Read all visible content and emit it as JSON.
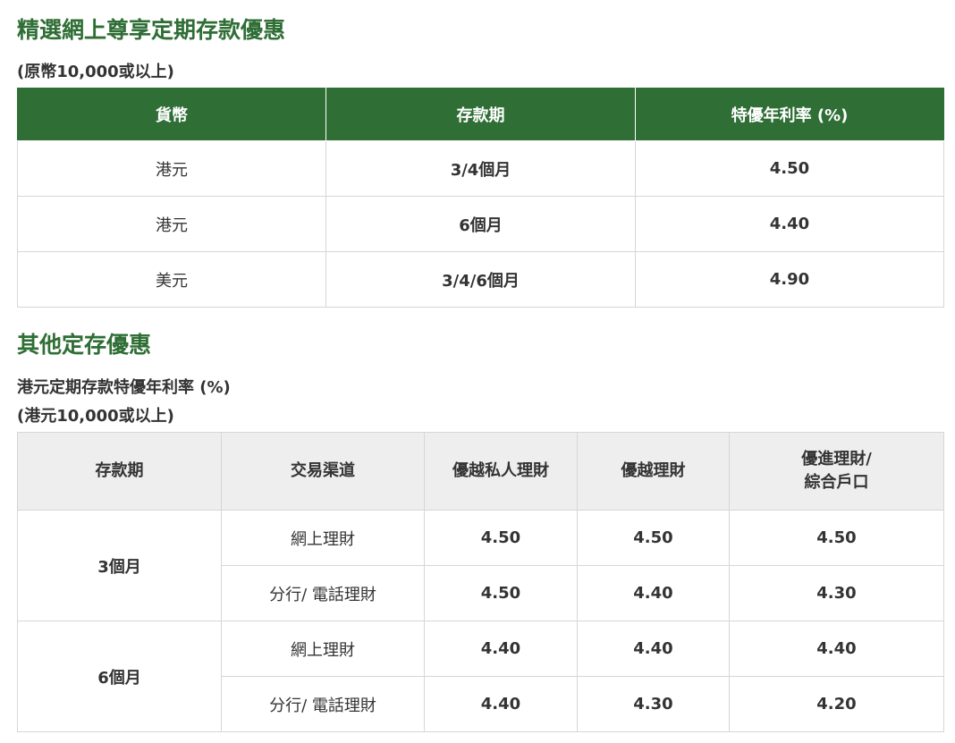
{
  "section1": {
    "title": "精選網上尊享定期存款優惠",
    "note": "(原幣10,000或以上)",
    "headers": [
      "貨幣",
      "存款期",
      "特優年利率 (%)"
    ],
    "rows": [
      [
        "港元",
        "3/4個月",
        "4.50"
      ],
      [
        "港元",
        "6個月",
        "4.40"
      ],
      [
        "美元",
        "3/4/6個月",
        "4.90"
      ]
    ]
  },
  "section2": {
    "title": "其他定存優惠",
    "subtitle": "港元定期存款特優年利率 (%)",
    "note": "(港元10,000或以上)",
    "headers": [
      "存款期",
      "交易渠道",
      "優越私人理財",
      "優越理財",
      "優進理財/",
      "綜合戶口"
    ],
    "groups": [
      {
        "term": "3個月",
        "rows": [
          [
            "網上理財",
            "4.50",
            "4.50",
            "4.50"
          ],
          [
            "分行/ 電話理財",
            "4.50",
            "4.40",
            "4.30"
          ]
        ]
      },
      {
        "term": "6個月",
        "rows": [
          [
            "網上理財",
            "4.40",
            "4.40",
            "4.40"
          ],
          [
            "分行/ 電話理財",
            "4.40",
            "4.30",
            "4.20"
          ]
        ]
      }
    ]
  }
}
